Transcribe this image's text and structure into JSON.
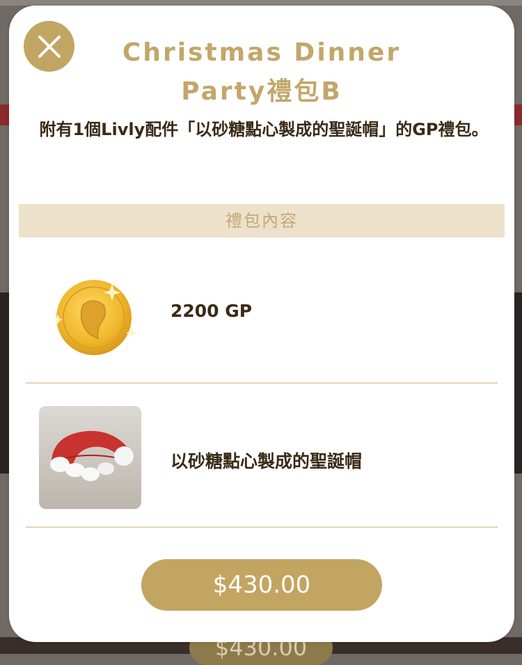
{
  "background": {
    "price_label": "$430.00"
  },
  "modal": {
    "title_line1": "Christmas Dinner",
    "title_line2": "Party禮包B",
    "description": "附有1個Livly配件「以砂糖點心製成的聖誕帽」的GP禮包。",
    "section_header": "禮包內容",
    "items": [
      {
        "icon": "gold-coin-icon",
        "label": "2200 GP"
      },
      {
        "icon": "santa-hat-icon",
        "label": "以砂糖點心製成的聖誕帽"
      }
    ],
    "buy_label": "$430.00",
    "close_icon": "close-icon"
  },
  "colors": {
    "accent": "#c1a562",
    "title": "#c3a66a",
    "section_bg": "#ede1cb",
    "text": "#3a2a16"
  }
}
